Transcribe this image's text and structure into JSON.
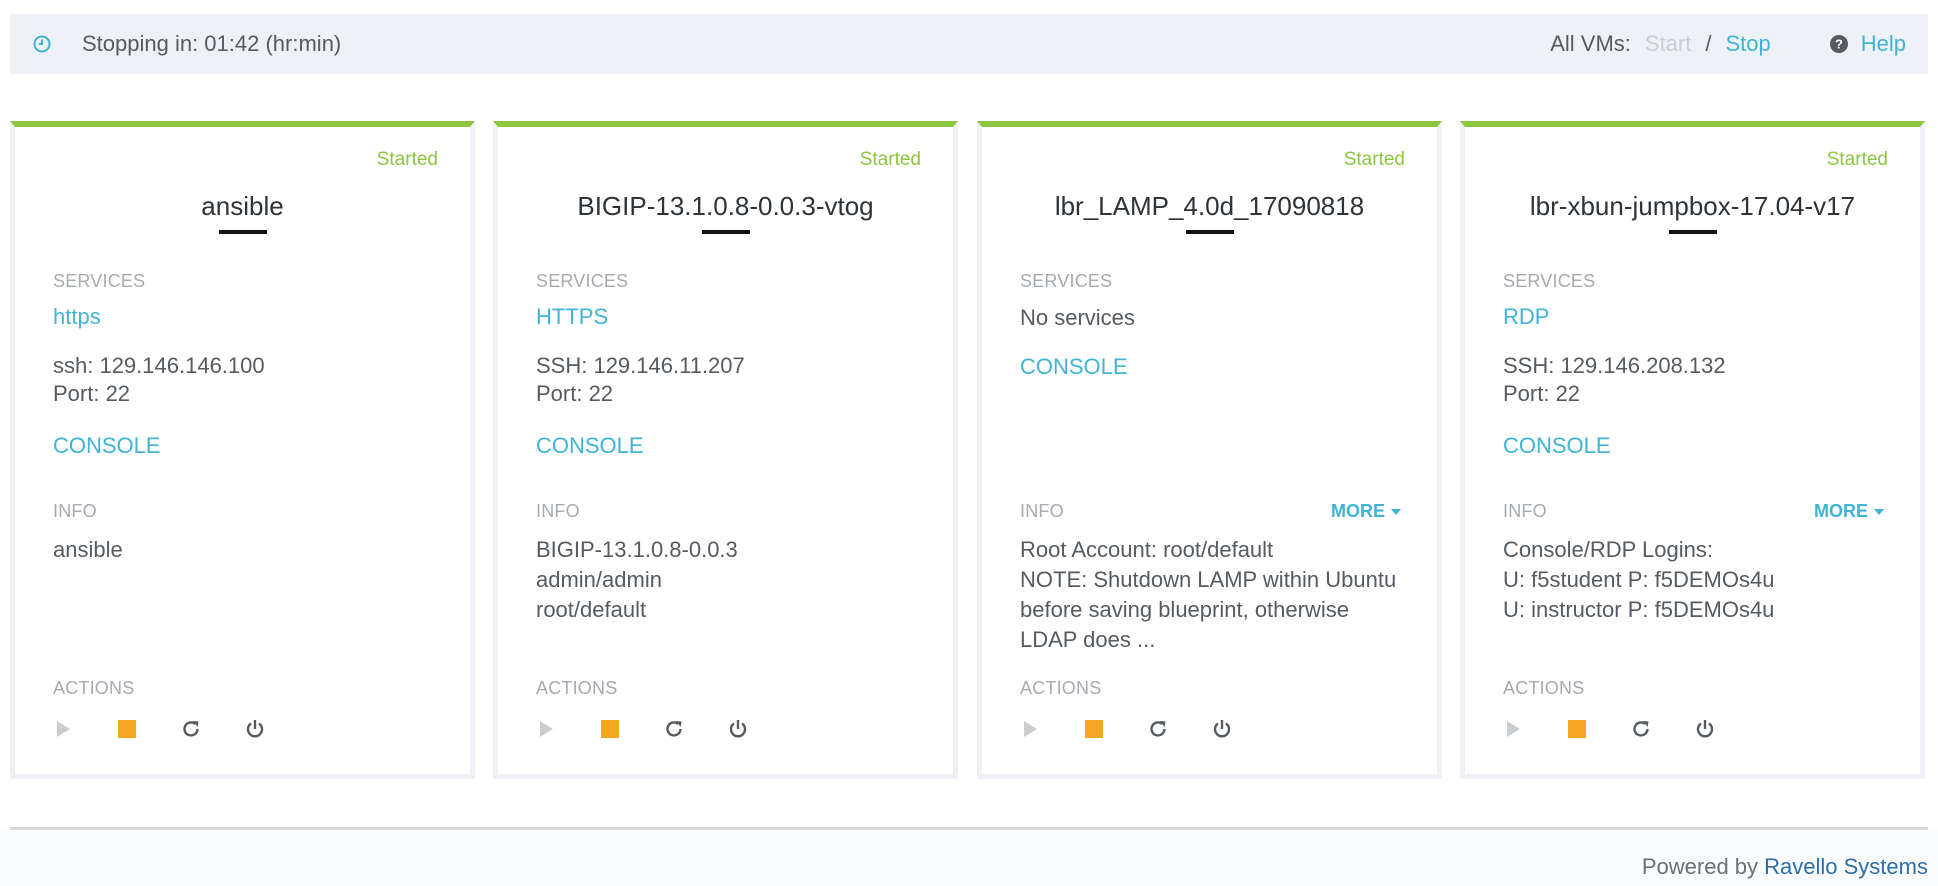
{
  "topbar": {
    "clock_icon": "clock-icon",
    "stopping_text": "Stopping in: 01:42 (hr:min)",
    "all_vms_label": "All VMs:",
    "start_label": "Start",
    "slash": "/",
    "stop_label": "Stop",
    "help_icon": "question-circle-icon",
    "help_label": "Help"
  },
  "colors": {
    "accent": "#3fb4d6",
    "started": "#8cc63f",
    "stop_action": "#f5a623",
    "brand": "#2e6ea6"
  },
  "labels": {
    "services": "SERVICES",
    "info": "INFO",
    "actions": "ACTIONS",
    "console": "CONSOLE",
    "more": "MORE"
  },
  "vms": [
    {
      "state": "Started",
      "name": "ansible",
      "service": "https",
      "ssh": "ssh: 129.146.146.100",
      "port": "Port: 22",
      "info": [
        "ansible"
      ]
    },
    {
      "state": "Started",
      "name": "BIGIP-13.1.0.8-0.0.3-vtog",
      "service": "HTTPS",
      "ssh": "SSH: 129.146.11.207",
      "port": "Port: 22",
      "info": [
        "BIGIP-13.1.0.8-0.0.3",
        "admin/admin",
        "root/default"
      ]
    },
    {
      "state": "Started",
      "name": "lbr_LAMP_4.0d_17090818",
      "no_services": "No services",
      "info": [
        "Root Account: root/default",
        "NOTE: Shutdown LAMP within Ubuntu",
        "before saving blueprint, otherwise",
        "LDAP does ..."
      ]
    },
    {
      "state": "Started",
      "name": "lbr-xbun-jumpbox-17.04-v17",
      "service": "RDP",
      "ssh": "SSH: 129.146.208.132",
      "port": "Port: 22",
      "info": [
        "Console/RDP Logins:",
        "U: f5student P: f5DEMOs4u",
        "U: instructor P: f5DEMOs4u"
      ]
    }
  ],
  "actions_icons": [
    "play-icon",
    "stop-icon",
    "refresh-icon",
    "power-icon"
  ],
  "footer": {
    "powered_by": "Powered by",
    "brand": "Ravello Systems"
  }
}
